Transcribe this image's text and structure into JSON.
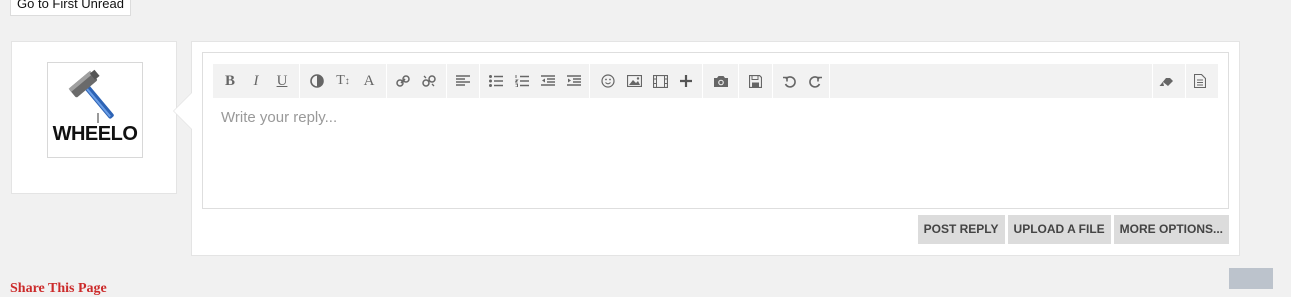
{
  "nav": {
    "first_unread_label": "Go to First Unread"
  },
  "avatar": {
    "text": "WHEELO",
    "icon": "hammer-icon"
  },
  "editor": {
    "placeholder": "Write your reply...",
    "toolbar": [
      "bold",
      "italic",
      "underline",
      "text-color",
      "font-size",
      "font-family",
      "link",
      "unlink",
      "align",
      "bullet-list",
      "numbered-list",
      "outdent",
      "indent",
      "smilies",
      "image",
      "media",
      "insert",
      "screenshot",
      "save-draft",
      "undo",
      "redo",
      "remove-formatting",
      "toggle-bbcode"
    ]
  },
  "actions": {
    "post_reply": "POST REPLY",
    "upload_file": "UPLOAD A FILE",
    "more_options": "MORE OPTIONS..."
  },
  "footer": {
    "share_label": "Share This Page"
  },
  "colors": {
    "accent": "#cc2b2b",
    "button_bg": "#dcdcdc",
    "toolbar_bg": "#f2f2f2"
  }
}
